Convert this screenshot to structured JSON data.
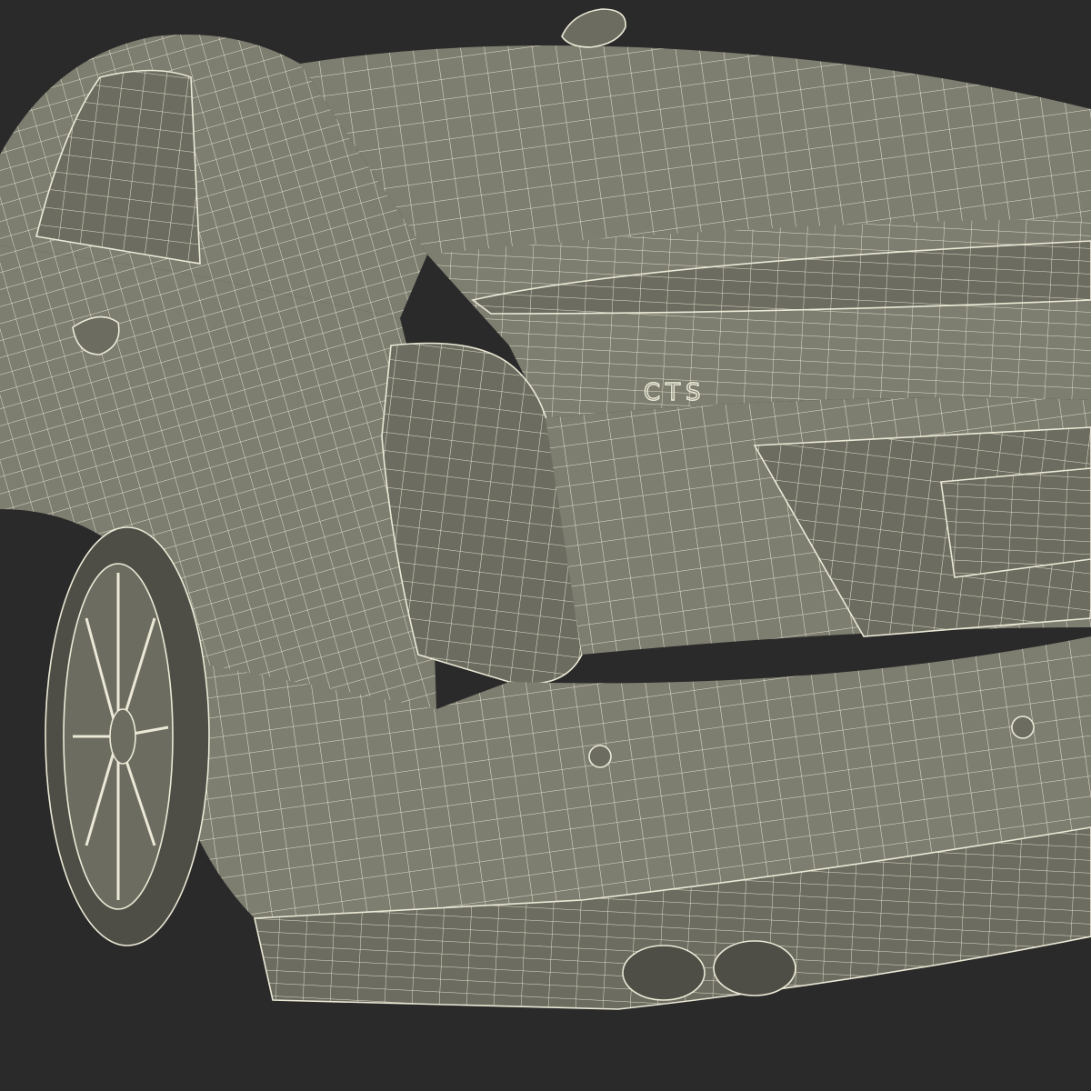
{
  "scene": {
    "background_color": "#2a2a2a",
    "body_color": "#7d7d70",
    "body_shadow_color": "#6c6c60",
    "wire_color": "#ece9d6",
    "tire_color": "#4e4e46",
    "badge_text": "CTS"
  }
}
